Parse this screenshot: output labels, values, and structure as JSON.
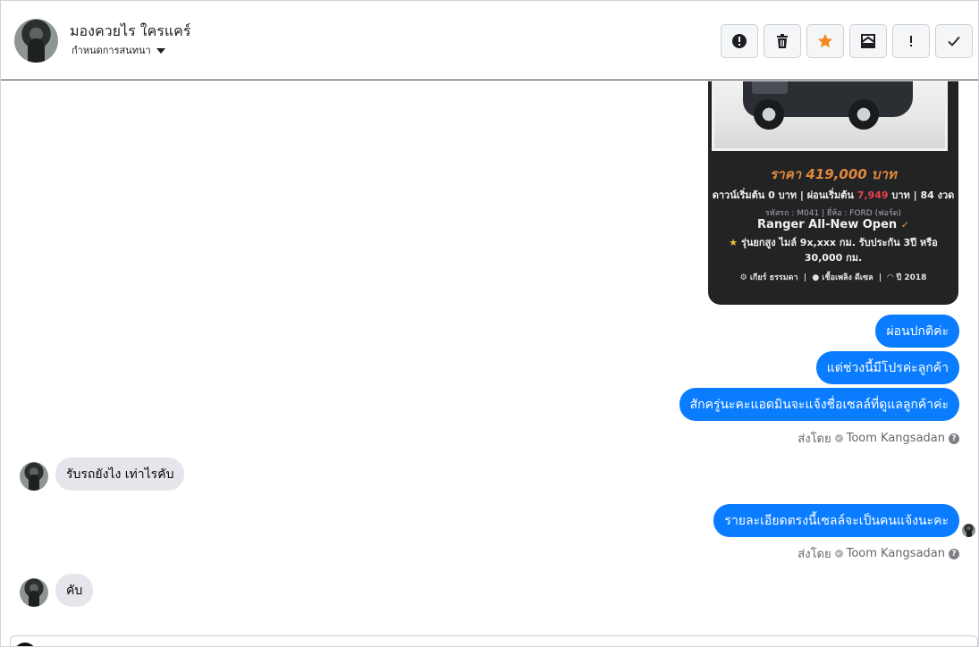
{
  "header": {
    "contact_name": "มองควยไร ใครแคร์",
    "conversation_setting": "กำหนดการสนทนา",
    "toolbar": {
      "icons": [
        "alert-circle-icon",
        "trash-icon",
        "star-icon",
        "mark-unread-icon",
        "exclamation-icon",
        "check-icon"
      ],
      "star_color": "#f5871f"
    }
  },
  "card": {
    "price": "ราคา 419,000 บาท",
    "down_prefix": "ดาวน์เริ่มต้น 0 บาท | ผ่อนเริ่มต้น",
    "installment": "7,949",
    "down_suffix": "บาท | 84 งวด",
    "codes": "รหัสรถ : M041 | ยี่ห้อ : FORD (ฟอร์ด)",
    "model": "Ranger All-New Open",
    "description": "รุ่นยกสูง ไมล์ 9x,xxx กม. รับประกัน 3ปี หรือ 30,000 กม.",
    "specs": [
      "เกียร์ ธรรมดา",
      "เชื้อเพลิง ดีเซล",
      "ปี 2018"
    ]
  },
  "messages": {
    "out1": "ผ่อนปกติค่ะ",
    "out2": "แต่ช่วงนี้มีโปรค่ะลูกค้า",
    "out3": "สักครู่นะคะแอดมินจะแจ้งชื่อเซลล์ที่ดูแลลูกค้าค่ะ",
    "sent_by_label": "ส่งโดย",
    "sent_by_name": "Toom Kangsadan",
    "in1": "รับรถยังไง เท่าไรคับ",
    "out4": "รายละเอียดตรงนี้เซลล์จะเป็นคนแจ้งนะคะ",
    "in2": "คับ"
  },
  "colors": {
    "outgoing_bubble": "#0a7cff",
    "incoming_bubble": "#e4e6eb",
    "card_background": "#222325",
    "price_text": "#e0893a",
    "installment_highlight": "#e8434d"
  }
}
